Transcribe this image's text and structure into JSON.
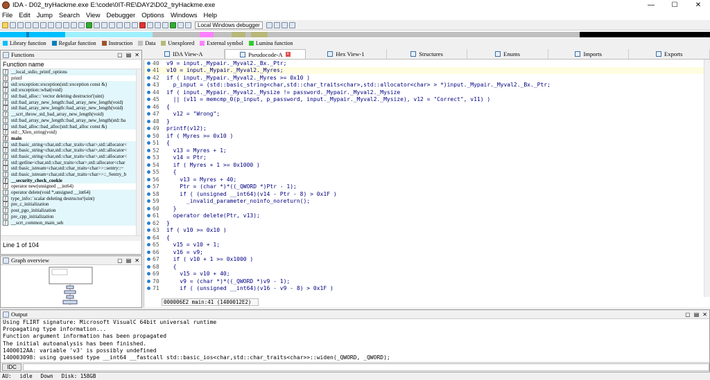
{
  "window": {
    "title": "IDA - D02_tryHackme.exe E:\\code\\0IT-RE\\DAY2\\D02_tryHackme.exe",
    "min": "—",
    "max": "☐",
    "close": "✕"
  },
  "menu": [
    "File",
    "Edit",
    "Jump",
    "Search",
    "View",
    "Debugger",
    "Options",
    "Windows",
    "Help"
  ],
  "toolbar": {
    "debugger_select": "Local Windows debugger"
  },
  "legend": [
    {
      "label": "Library function",
      "color": "#00bfff"
    },
    {
      "label": "Regular function",
      "color": "#0080c0"
    },
    {
      "label": "Instruction",
      "color": "#a0522d"
    },
    {
      "label": "Data",
      "color": "#c0c0c0"
    },
    {
      "label": "Unexplored",
      "color": "#b8b87a"
    },
    {
      "label": "External symbol",
      "color": "#ff80ff"
    },
    {
      "label": "Lumina function",
      "color": "#33cc33"
    }
  ],
  "tabs": [
    {
      "label": "IDA View-A",
      "active": false,
      "closable": false
    },
    {
      "label": "Pseudocode-A",
      "active": true,
      "closable": true
    },
    {
      "label": "Hex View-1",
      "active": false,
      "closable": false
    },
    {
      "label": "Structures",
      "active": false,
      "closable": false
    },
    {
      "label": "Enums",
      "active": false,
      "closable": false
    },
    {
      "label": "Imports",
      "active": false,
      "closable": false
    },
    {
      "label": "Exports",
      "active": false,
      "closable": false
    }
  ],
  "functions": {
    "title": "Functions",
    "header": "Function name",
    "status": "Line 1 of 104",
    "items": [
      {
        "name": "__local_stdio_printf_options",
        "lib": true
      },
      {
        "name": "printf",
        "lib": false
      },
      {
        "name": "std::exception::exception(std::exception const &)",
        "lib": true
      },
      {
        "name": "std::exception::what(void)",
        "lib": true
      },
      {
        "name": "std::bad_alloc::`vector deleting destructor'(uint)",
        "lib": true
      },
      {
        "name": "std::bad_array_new_length::bad_array_new_length(void)",
        "lib": true
      },
      {
        "name": "std::bad_array_new_length::bad_array_new_length(void)",
        "lib": true
      },
      {
        "name": "__scrt_throw_std_bad_array_new_length(void)",
        "lib": true
      },
      {
        "name": "std::bad_array_new_length::bad_array_new_length(std::ba",
        "lib": true
      },
      {
        "name": "std::bad_alloc::bad_alloc(std::bad_alloc const &)",
        "lib": true
      },
      {
        "name": "std::_Xlen_string(void)",
        "lib": false
      },
      {
        "name": "main",
        "lib": false,
        "bold": true
      },
      {
        "name": "std::basic_string<char,std::char_traits<char>,std::allocator<",
        "lib": true
      },
      {
        "name": "std::basic_string<char,std::char_traits<char>,std::allocator<",
        "lib": true
      },
      {
        "name": "std::basic_string<char,std::char_traits<char>,std::allocator<",
        "lib": true
      },
      {
        "name": "std::getline<char,std::char_traits<char>,std::allocator<char",
        "lib": true
      },
      {
        "name": "std::basic_istream<char,std::char_traits<char>>::sentry::~",
        "lib": true
      },
      {
        "name": "std::basic_istream<char,std::char_traits<char>>::_Sentry_b",
        "lib": true
      },
      {
        "name": "__security_check_cookie",
        "lib": true,
        "bold": true
      },
      {
        "name": "operator new(unsigned __int64)",
        "lib": false
      },
      {
        "name": "operator delete(void *,unsigned __int64)",
        "lib": true
      },
      {
        "name": "type_info::`scalar deleting destructor'(uint)",
        "lib": true
      },
      {
        "name": "pre_c_initialization",
        "lib": true
      },
      {
        "name": "post_pgo_initialization",
        "lib": true
      },
      {
        "name": "pre_cpp_initialization",
        "lib": true
      },
      {
        "name": "__scrt_common_main_seh",
        "lib": true
      }
    ]
  },
  "graph": {
    "title": "Graph overview"
  },
  "code": {
    "status": "000006E2 main:41 (1400012E2)",
    "lines": [
      {
        "n": "40",
        "t": "v9 = input._Mypair._Myval2._Bx._Ptr;"
      },
      {
        "n": "41",
        "t": "v10 = input._Mypair._Myval2._Myres;",
        "hl": true
      },
      {
        "n": "42",
        "t": "if ( input._Mypair._Myval2._Myres >= 0x10 )"
      },
      {
        "n": "43",
        "t": "  p_input = (std::basic_string<char,std::char_traits<char>,std::allocator<char> > *)input._Mypair._Myval2._Bx._Ptr;"
      },
      {
        "n": "44",
        "t": "if ( input._Mypair._Myval2._Mysize != password._Mypair._Myval2._Mysize"
      },
      {
        "n": "45",
        "t": "  || (v11 = memcmp_0(p_input, p_password, input._Mypair._Myval2._Mysize), v12 = \"Correct\", v11) )"
      },
      {
        "n": "46",
        "t": "{"
      },
      {
        "n": "47",
        "t": "  v12 = \"Wrong\";"
      },
      {
        "n": "48",
        "t": "}"
      },
      {
        "n": "49",
        "t": "printf(v12);"
      },
      {
        "n": "50",
        "t": "if ( Myres >= 0x10 )"
      },
      {
        "n": "51",
        "t": "{"
      },
      {
        "n": "52",
        "t": "  v13 = Myres + 1;"
      },
      {
        "n": "53",
        "t": "  v14 = Ptr;"
      },
      {
        "n": "54",
        "t": "  if ( Myres + 1 >= 0x1000 )"
      },
      {
        "n": "55",
        "t": "  {"
      },
      {
        "n": "56",
        "t": "    v13 = Myres + 40;"
      },
      {
        "n": "57",
        "t": "    Ptr = (char *)*((_QWORD *)Ptr - 1);"
      },
      {
        "n": "58",
        "t": "    if ( (unsigned __int64)(v14 - Ptr - 8) > 0x1F )"
      },
      {
        "n": "59",
        "t": "      _invalid_parameter_noinfo_noreturn();"
      },
      {
        "n": "60",
        "t": "  }"
      },
      {
        "n": "61",
        "t": "  operator delete(Ptr, v13);"
      },
      {
        "n": "62",
        "t": "}"
      },
      {
        "n": "63",
        "t": "if ( v10 >= 0x10 )"
      },
      {
        "n": "64",
        "t": "{"
      },
      {
        "n": "65",
        "t": "  v15 = v10 + 1;"
      },
      {
        "n": "66",
        "t": "  v16 = v9;"
      },
      {
        "n": "67",
        "t": "  if ( v10 + 1 >= 0x1000 )"
      },
      {
        "n": "68",
        "t": "  {"
      },
      {
        "n": "69",
        "t": "    v15 = v10 + 40;"
      },
      {
        "n": "70",
        "t": "    v9 = (char *)*((_QWORD *)v9 - 1);"
      },
      {
        "n": "71",
        "t": "    if ( (unsigned __int64)(v16 - v9 - 8) > 0x1F )"
      }
    ]
  },
  "output": {
    "title": "Output",
    "lines": [
      "Using FLIRT signature: Microsoft VisualC 64bit universal runtime",
      "Propagating type information...",
      "Function argument information has been propagated",
      "The initial autoanalysis has been finished.",
      "1400012AA: variable 'v3' is possibly undefined",
      "140003098: using guessed type __int64 __fastcall std::basic_ios<char,std::char_traits<char>>::widen(_QWORD, _QWORD);"
    ],
    "cmd_label": "IDC"
  },
  "status": {
    "au": "AU:",
    "state": "idle",
    "dir": "Down",
    "disk": "Disk: 158GB"
  }
}
